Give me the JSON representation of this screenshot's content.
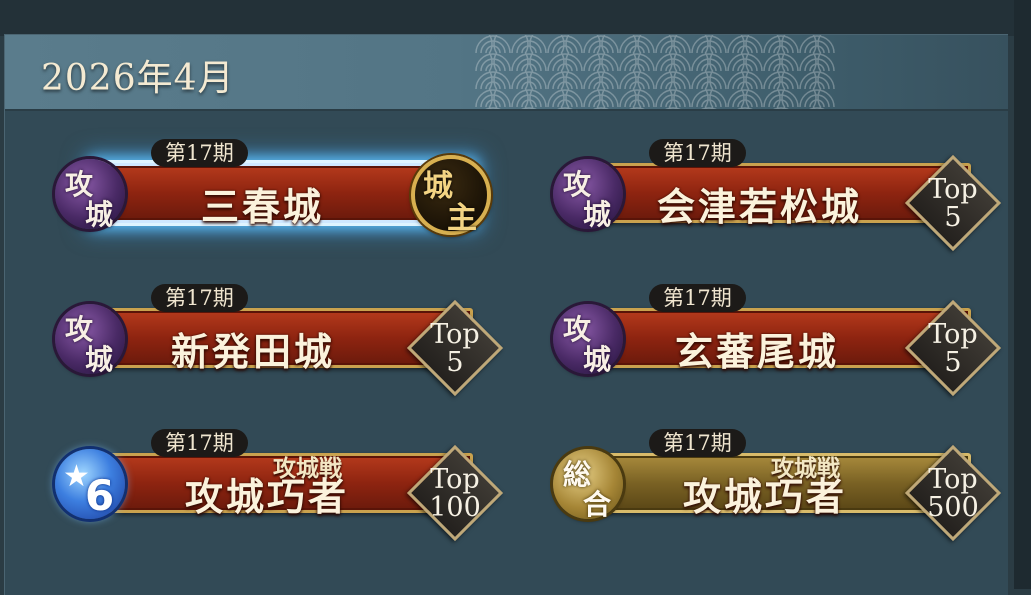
{
  "header": {
    "title": "2026年4月"
  },
  "badges": [
    {
      "emblem_top": "攻",
      "emblem_bottom": "城",
      "period": "第17期",
      "subtitle": "",
      "name": "三春城",
      "rank_icon": "lord-badge",
      "rank_top": "城",
      "rank_bottom": "主",
      "selected": true
    },
    {
      "emblem_top": "攻",
      "emblem_bottom": "城",
      "period": "第17期",
      "subtitle": "",
      "name": "会津若松城",
      "rank_top": "Top",
      "rank_bottom": "5",
      "selected": false
    },
    {
      "emblem_top": "攻",
      "emblem_bottom": "城",
      "period": "第17期",
      "subtitle": "",
      "name": "新発田城",
      "rank_top": "Top",
      "rank_bottom": "5",
      "selected": false
    },
    {
      "emblem_top": "攻",
      "emblem_bottom": "城",
      "period": "第17期",
      "subtitle": "",
      "name": "玄蕃尾城",
      "rank_top": "Top",
      "rank_bottom": "5",
      "selected": false
    },
    {
      "emblem_star": "★",
      "emblem_number": "6",
      "period": "第17期",
      "subtitle": "攻城戦",
      "name": "攻城巧者",
      "rank_top": "Top",
      "rank_bottom": "100",
      "selected": false
    },
    {
      "emblem_top": "総",
      "emblem_bottom": "合",
      "period": "第17期",
      "subtitle": "攻城戦",
      "name": "攻城巧者",
      "rank_top": "Top",
      "rank_bottom": "500",
      "selected": false
    }
  ],
  "colors": {
    "panel": "#324a56",
    "banner_red": "#8e2410",
    "banner_gold": "#7a6224",
    "frame_gold": "#c9a24e",
    "selected_glow": "#5ab8f0"
  }
}
